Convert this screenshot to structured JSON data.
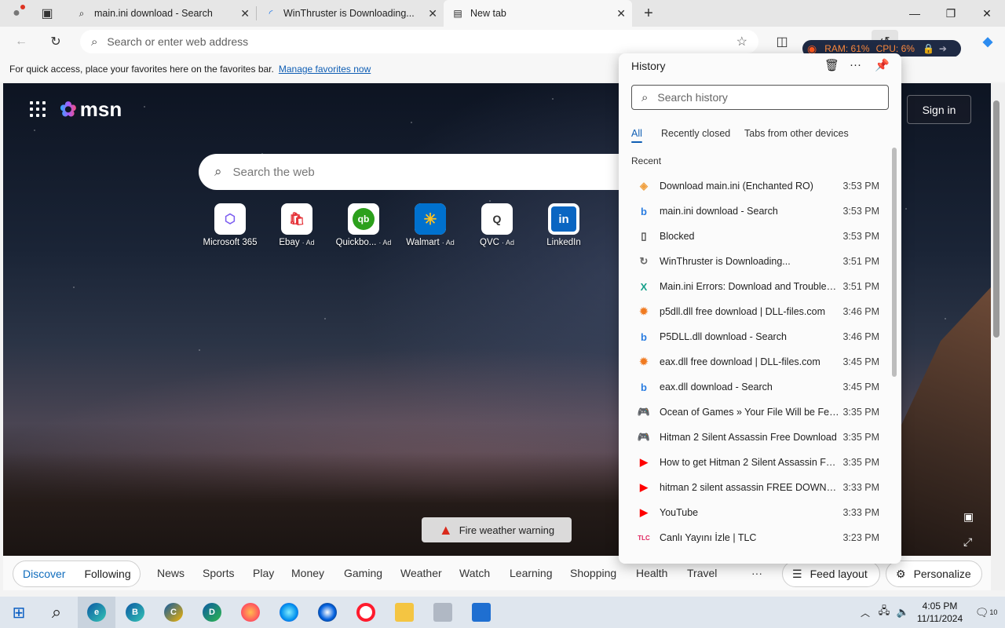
{
  "tabs": [
    {
      "title": "main.ini download - Search",
      "icon": "search-icon",
      "active": false
    },
    {
      "title": "WinThruster is Downloading...",
      "icon": "loading-icon",
      "active": false
    },
    {
      "title": "New tab",
      "icon": "newtab-icon",
      "active": true
    }
  ],
  "address_bar": {
    "placeholder": "Search or enter web address"
  },
  "perf_overlay": {
    "ram": "RAM: 61%",
    "cpu": "CPU: 6%"
  },
  "favorites_bar": {
    "message": "For quick access, place your favorites here on the favorites bar.",
    "link": "Manage favorites now"
  },
  "msn": {
    "logo_text": "msn",
    "search_placeholder": "Search the web",
    "sign_in": "Sign in",
    "tiles": [
      {
        "label": "Microsoft 365",
        "ad": "",
        "icon": "microsoft365-icon",
        "color": "#7b5cf0"
      },
      {
        "label": "Ebay",
        "ad": "· Ad",
        "icon": "ebay-icon",
        "color": "#e53238"
      },
      {
        "label": "Quickbo...",
        "ad": "· Ad",
        "icon": "quickbooks-icon",
        "color": "#2ca01c"
      },
      {
        "label": "Walmart",
        "ad": "· Ad",
        "icon": "walmart-icon",
        "color": "#0071ce"
      },
      {
        "label": "QVC",
        "ad": "· Ad",
        "icon": "qvc-icon",
        "color": "#333333"
      },
      {
        "label": "LinkedIn",
        "ad": "",
        "icon": "linkedin-icon",
        "color": "#0a66c2"
      }
    ],
    "alert": "Fire weather warning"
  },
  "bottom_nav": {
    "discover": "Discover",
    "following": "Following",
    "items": [
      "News",
      "Sports",
      "Play",
      "Money",
      "Gaming",
      "Weather",
      "Watch",
      "Learning",
      "Shopping",
      "Health",
      "Travel"
    ],
    "more": "···",
    "feed_layout": "Feed layout",
    "personalize": "Personalize"
  },
  "history": {
    "title": "History",
    "search_placeholder": "Search history",
    "tabs": [
      "All",
      "Recently closed",
      "Tabs from other devices"
    ],
    "section": "Recent",
    "items": [
      {
        "title": "Download main.ini (Enchanted RO)",
        "time": "3:53 PM",
        "icon": "diamond-icon",
        "color": "#f0a040",
        "glyph": "◈"
      },
      {
        "title": "main.ini download - Search",
        "time": "3:53 PM",
        "icon": "bing-icon",
        "color": "#2a7de1",
        "glyph": "b"
      },
      {
        "title": "Blocked",
        "time": "3:53 PM",
        "icon": "page-icon",
        "color": "#444444",
        "glyph": "▯"
      },
      {
        "title": "WinThruster is Downloading...",
        "time": "3:51 PM",
        "icon": "loading-icon",
        "color": "#666666",
        "glyph": "↻"
      },
      {
        "title": "Main.ini Errors: Download and Troubleshoot",
        "time": "3:51 PM",
        "icon": "x-icon",
        "color": "#16a08a",
        "glyph": "X"
      },
      {
        "title": "p5dll.dll free download | DLL-files.com",
        "time": "3:46 PM",
        "icon": "gear-icon",
        "color": "#f07a20",
        "glyph": "✹"
      },
      {
        "title": "P5DLL.dll download - Search",
        "time": "3:46 PM",
        "icon": "bing-icon",
        "color": "#2a7de1",
        "glyph": "b"
      },
      {
        "title": "eax.dll free download | DLL-files.com",
        "time": "3:45 PM",
        "icon": "gear-icon",
        "color": "#f07a20",
        "glyph": "✹"
      },
      {
        "title": "eax.dll download - Search",
        "time": "3:45 PM",
        "icon": "bing-icon",
        "color": "#2a7de1",
        "glyph": "b"
      },
      {
        "title": "Ocean of Games » Your File Will be Fetched",
        "time": "3:35 PM",
        "icon": "gamepad-icon",
        "color": "#c0202a",
        "glyph": "🎮"
      },
      {
        "title": "Hitman 2 Silent Assassin Free Download",
        "time": "3:35 PM",
        "icon": "gamepad-icon",
        "color": "#c0202a",
        "glyph": "🎮"
      },
      {
        "title": "How to get Hitman 2 Silent Assassin For Free",
        "time": "3:35 PM",
        "icon": "youtube-icon",
        "color": "#ff0000",
        "glyph": "▶"
      },
      {
        "title": "hitman 2 silent assassin FREE DOWNLOAD",
        "time": "3:33 PM",
        "icon": "youtube-icon",
        "color": "#ff0000",
        "glyph": "▶"
      },
      {
        "title": "YouTube",
        "time": "3:33 PM",
        "icon": "youtube-icon",
        "color": "#ff0000",
        "glyph": "▶"
      },
      {
        "title": "Canlı Yayını İzle | TLC",
        "time": "3:23 PM",
        "icon": "tlc-icon",
        "color": "#e0245e",
        "glyph": "TLC"
      }
    ]
  },
  "taskbar": {
    "time": "4:05 PM",
    "date": "11/11/2024",
    "notifications": "10"
  }
}
